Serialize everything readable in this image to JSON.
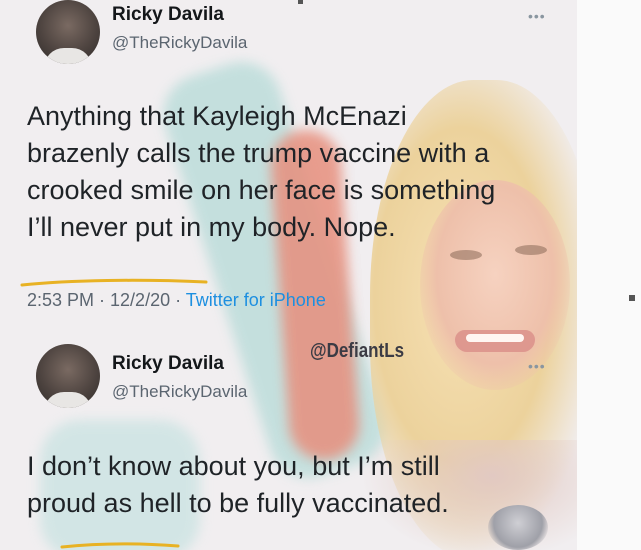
{
  "tweets": [
    {
      "name": "Ricky Davila",
      "handle": "@TheRickyDavila",
      "more": "•••",
      "text": "Anything that Kayleigh McEnazi\nbrazenly calls the trump vaccine with a\ncrooked smile on her face is something\nI’ll never put in my body. Nope.",
      "timestamp": "2:53 PM · 12/2/20 · ",
      "source": "Twitter for iPhone"
    },
    {
      "name": "Ricky Davila",
      "handle": "@TheRickyDavila",
      "more": "•••",
      "text": "I don’t know about you, but I’m still\nproud as hell to be fully vaccinated."
    }
  ],
  "watermark": "@DefiantLs",
  "colors": {
    "name": "#14171a",
    "handle": "#5b6570",
    "link": "#1d8fe0",
    "annotation": "#e8b224"
  }
}
